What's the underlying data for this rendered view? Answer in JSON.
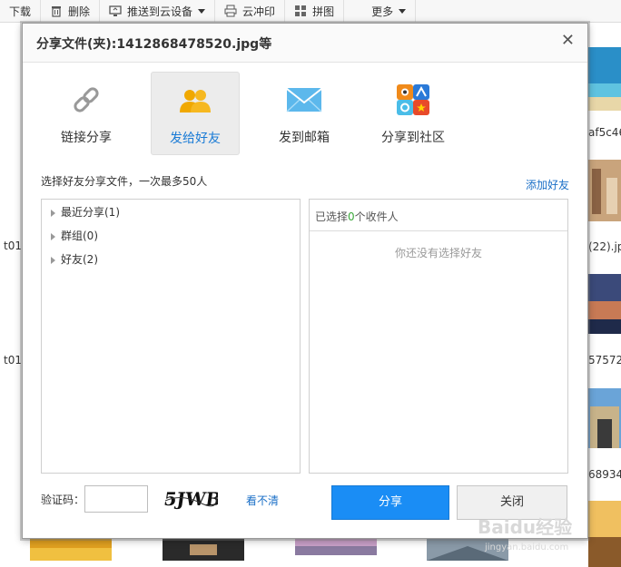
{
  "toolbar": {
    "download": "下载",
    "delete": "删除",
    "push": "推送到云设备",
    "print": "云冲印",
    "collage": "拼图",
    "more": "更多"
  },
  "background": {
    "file_label_1": "af5c46",
    "file_label_2": "(22).jp",
    "file_label_3": "57572",
    "file_label_4": "68934",
    "left_label_1": "t01",
    "left_label_2": "t01"
  },
  "dialog": {
    "title": "分享文件(夹):1412868478520.jpg等",
    "close_glyph": "✕",
    "tabs": [
      {
        "label": "链接分享",
        "icon": "link-icon"
      },
      {
        "label": "发给好友",
        "icon": "friends-icon"
      },
      {
        "label": "发到邮箱",
        "icon": "mail-icon"
      },
      {
        "label": "分享到社区",
        "icon": "community-icon"
      }
    ],
    "hint": "选择好友分享文件，一次最多50人",
    "add_friend": "添加好友",
    "tree": [
      {
        "label": "最近分享(1)"
      },
      {
        "label": "群组(0)"
      },
      {
        "label": "好友(2)"
      }
    ],
    "selected": {
      "prefix": "已选择",
      "count": "0",
      "suffix": "个收件人",
      "empty": "你还没有选择好友"
    },
    "captcha": {
      "label": "验证码：",
      "value": "",
      "image_text": "5JWB",
      "refresh": "看不清"
    },
    "share_button": "分享",
    "close_button": "关闭"
  },
  "watermark": {
    "brand": "Baidu经验",
    "url": "jingyan.baidu.com"
  },
  "colors": {
    "accent": "#1a8df5",
    "link": "#1a6fc7",
    "count_green": "#3aa83a"
  }
}
